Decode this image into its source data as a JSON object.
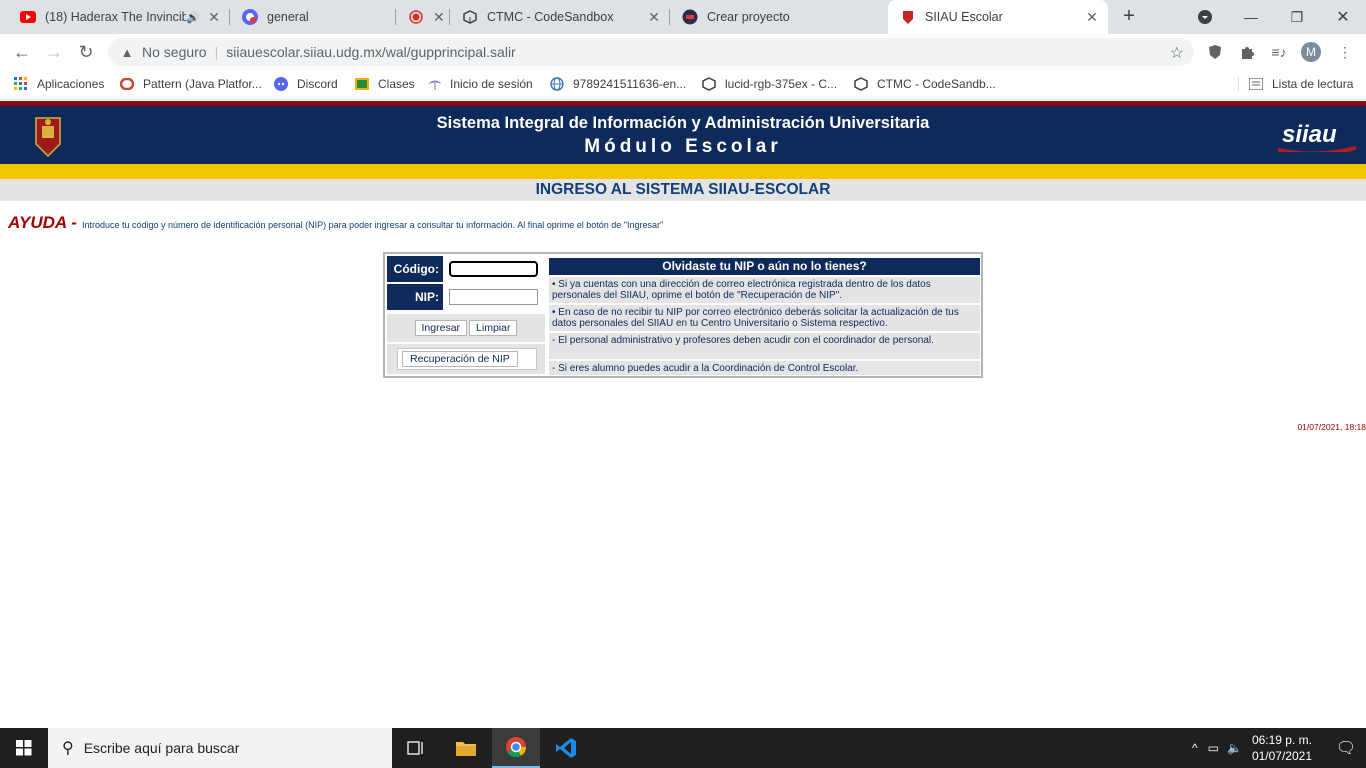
{
  "browser": {
    "tabs": [
      {
        "title": "(18) Haderax The Invincib",
        "icon": "youtube-icon",
        "audio": true
      },
      {
        "title": "general",
        "icon": "chat-app-icon"
      },
      {
        "title": "",
        "icon": "recording-icon"
      },
      {
        "title": "CTMC - CodeSandbox",
        "icon": "codesandbox-icon"
      },
      {
        "title": "Crear proyecto",
        "icon": "project-icon"
      },
      {
        "title": "SIIAU Escolar",
        "icon": "siiau-icon",
        "active": true
      }
    ],
    "address": {
      "security": "No seguro",
      "url_host": "siiauescolar.siiau.udg.mx",
      "url_path": "/wal/gupprincipal.salir"
    },
    "profile_initial": "M",
    "bookmarks": [
      {
        "label": "Aplicaciones",
        "icon": "apps-grid-icon"
      },
      {
        "label": "Pattern (Java Platfor...",
        "icon": "oracle-icon"
      },
      {
        "label": "Discord",
        "icon": "discord-icon"
      },
      {
        "label": "Clases",
        "icon": "classroom-icon"
      },
      {
        "label": "Inicio de sesión",
        "icon": "login-icon"
      },
      {
        "label": "9789241511636-en...",
        "icon": "globe-icon"
      },
      {
        "label": "lucid-rgb-375ex - C...",
        "icon": "codesandbox-icon"
      },
      {
        "label": "CTMC - CodeSandb...",
        "icon": "codesandbox-icon"
      }
    ],
    "reading_list": "Lista de lectura"
  },
  "page": {
    "header_title": "Sistema Integral de Información y Administración Universitaria",
    "header_subtitle": "Módulo Escolar",
    "logo_text": "siiau",
    "section_title": "INGRESO AL SISTEMA SIIAU-ESCOLAR",
    "help_label": "AYUDA -",
    "help_text": "Introduce tu código y número de identificación personal (NIP) para poder ingresar a consultar tu información. Al final oprime el botón de \"Ingresar\"",
    "login": {
      "codigo_label": "Código:",
      "codigo_value": "",
      "nip_label": "NIP:",
      "nip_value": "",
      "ingresar": "Ingresar",
      "limpiar": "Limpiar",
      "recuperacion": "Recuperación de NIP"
    },
    "info": {
      "heading": "Olvidaste tu NIP o aún no lo tienes?",
      "items": [
        "•    Si ya cuentas con una dirección de correo electrónica registrada dentro de los datos personales del SIIAU, oprime el botón de \"Recuperación de NIP\".",
        "•    En caso de no recibir tu NIP por correo electrónico deberás solicitar la actualización de tus datos personales del SIIAU en tu Centro Universitario o Sistema respectivo.",
        "     - El personal administrativo y profesores deben acudir con el coordinador de personal.",
        "     - Si eres alumno puedes acudir a la Coordinación de Control Escolar."
      ]
    },
    "timestamp": "01/07/2021, 18:18"
  },
  "taskbar": {
    "search_placeholder": "Escribe aquí para buscar",
    "time": "06:19 p. m.",
    "date": "01/07/2021"
  },
  "colors": {
    "navy": "#0d2a5a",
    "dark_red": "#8b0b12",
    "yellow": "#f3c600",
    "help_red": "#a30000"
  }
}
